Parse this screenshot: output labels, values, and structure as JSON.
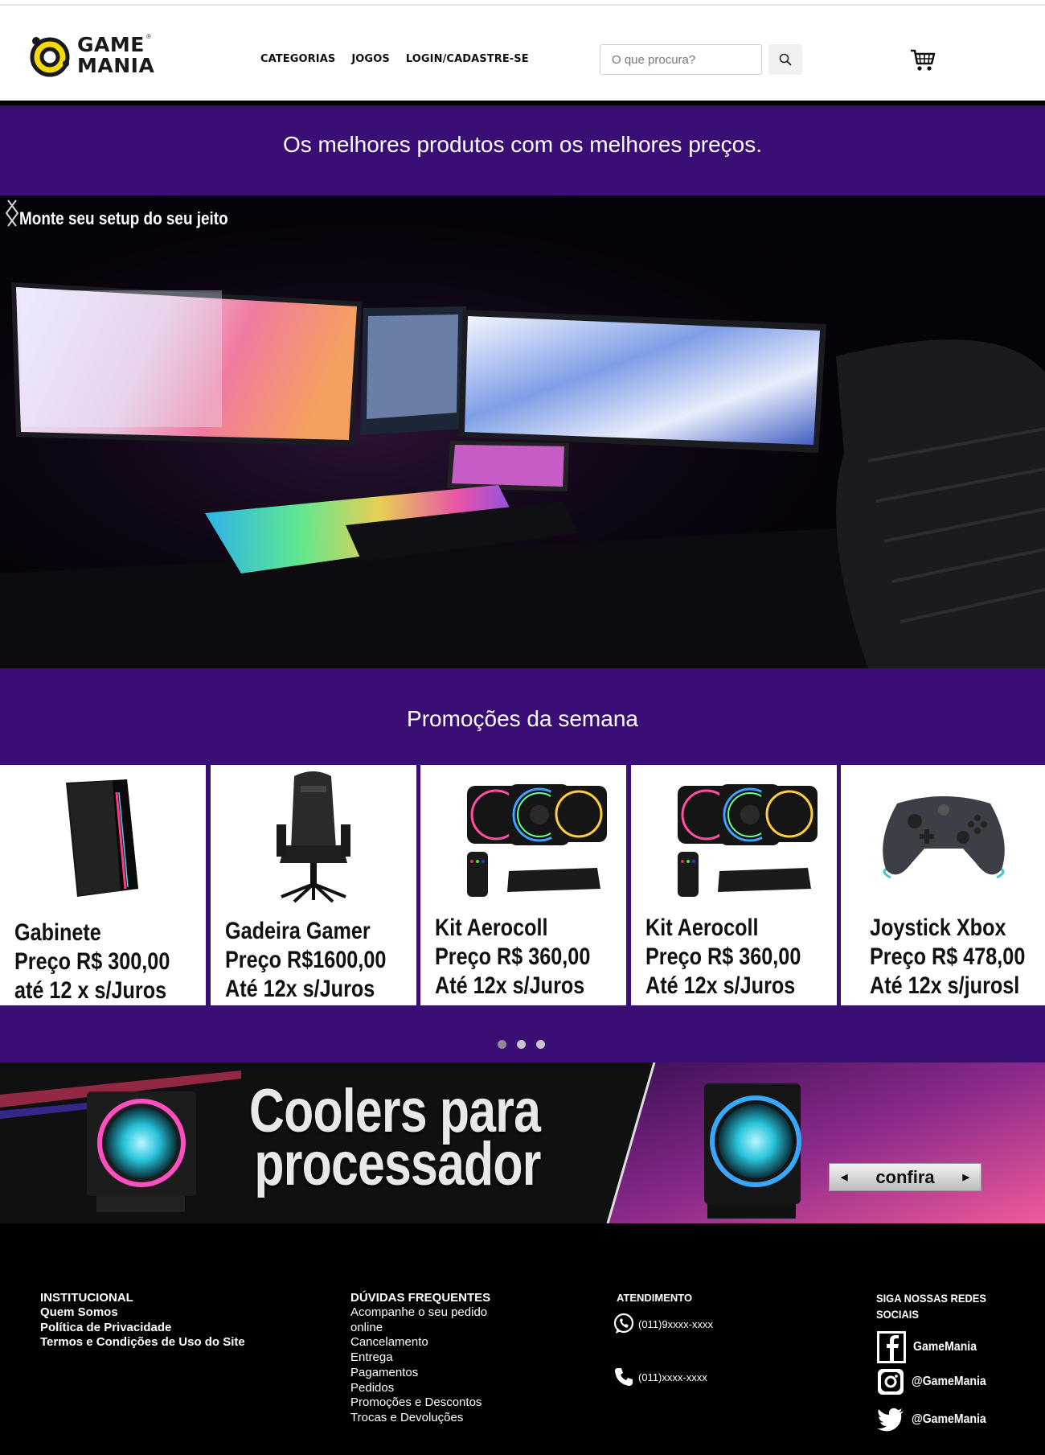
{
  "brand": {
    "logo_line1": "GAME",
    "logo_line2": "MANIA",
    "logo_reg": "®"
  },
  "nav": {
    "categorias": "CATEGORIAS",
    "jogos": "JOGOS",
    "login": "LOGIN/CADASTRE-SE"
  },
  "search": {
    "placeholder": "O que procura?"
  },
  "tagline": "Os melhores produtos com os melhores preços.",
  "hero": {
    "caption": "Monte seu setup do seu jeito"
  },
  "promo": {
    "title": "Promoções da semana",
    "cards": [
      {
        "name": "Gabinete",
        "price": "Preço R$ 300,00",
        "terms": "até 12 x s/Juros",
        "image": "gabinete"
      },
      {
        "name": "Gadeira Gamer",
        "price": "Preço R$1600,00",
        "terms": "Até 12x s/Juros",
        "image": "cadeira"
      },
      {
        "name": "Kit Aerocoll",
        "price": "Preço R$ 360,00",
        "terms": "Até 12x s/Juros",
        "image": "kit-fans"
      },
      {
        "name": "Kit Aerocoll",
        "price": "Preço R$ 360,00",
        "terms": "Até 12x s/Juros",
        "image": "kit-fans"
      },
      {
        "name": "Joystick Xbox",
        "price": "Preço R$ 478,00",
        "terms": "Até 12x s/jurosl",
        "image": "controle"
      }
    ],
    "carousel": {
      "pages": 3,
      "active": 1
    }
  },
  "banner": {
    "line1": "Coolers para",
    "line2": "processador",
    "cta": "confira"
  },
  "footer": {
    "institucional": {
      "title": "INSTITUCIONAL",
      "links": [
        "Quem Somos",
        "Política de Privacidade",
        "Termos e Condições de Uso do Site"
      ]
    },
    "duvidas": {
      "title": "DÚVIDAS FREQUENTES",
      "links": [
        "Acompanhe o seu pedido online",
        "Cancelamento",
        "Entrega",
        "Pagamentos",
        "Pedidos",
        "Promoções e Descontos",
        "Trocas e Devoluções"
      ]
    },
    "atendimento": {
      "title": "ATENDIMENTO",
      "whatsapp": "(011)9xxxx-xxxx",
      "phone": "(011)xxxx-xxxx"
    },
    "social": {
      "title": "SIGA  NOSSAS REDES SOCIAIS",
      "facebook": "GameMania",
      "instagram": "@GameMania",
      "twitter": "@GameMania"
    }
  },
  "colors": {
    "purple": "#3a0e75",
    "logo_yellow": "#f5d90a"
  }
}
